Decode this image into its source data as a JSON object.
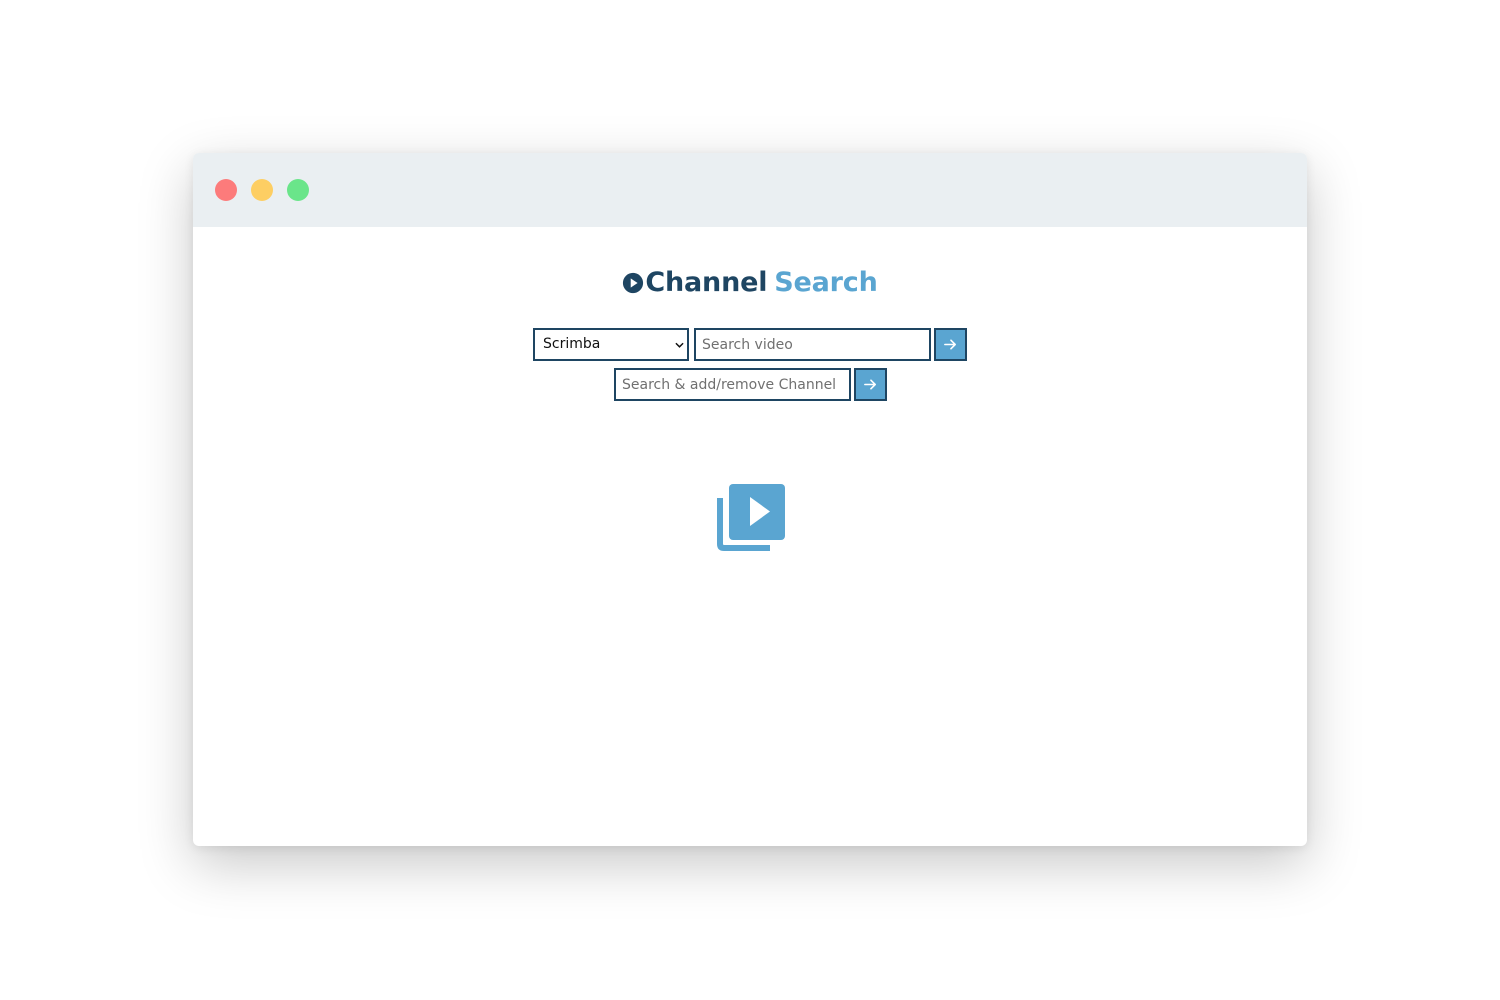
{
  "window": {
    "controls": [
      {
        "name": "close",
        "color": "#fc7b7b"
      },
      {
        "name": "minimize",
        "color": "#fdce63"
      },
      {
        "name": "maximize",
        "color": "#6ae58a"
      }
    ]
  },
  "brand": {
    "word1": "Channel",
    "word2": "Search",
    "logo_icon": "play-circle-icon"
  },
  "colors": {
    "dark": "#1e4562",
    "accent": "#5aa5d1",
    "titlebar": "#eaeff2"
  },
  "search": {
    "channel_select_value": "Scrimba",
    "video_placeholder": "Search video",
    "video_submit_icon": "arrow-right-icon",
    "channel_placeholder": "Search & add/remove Channel",
    "channel_submit_icon": "arrow-right-icon"
  },
  "empty_state": {
    "icon": "video-library-icon"
  }
}
